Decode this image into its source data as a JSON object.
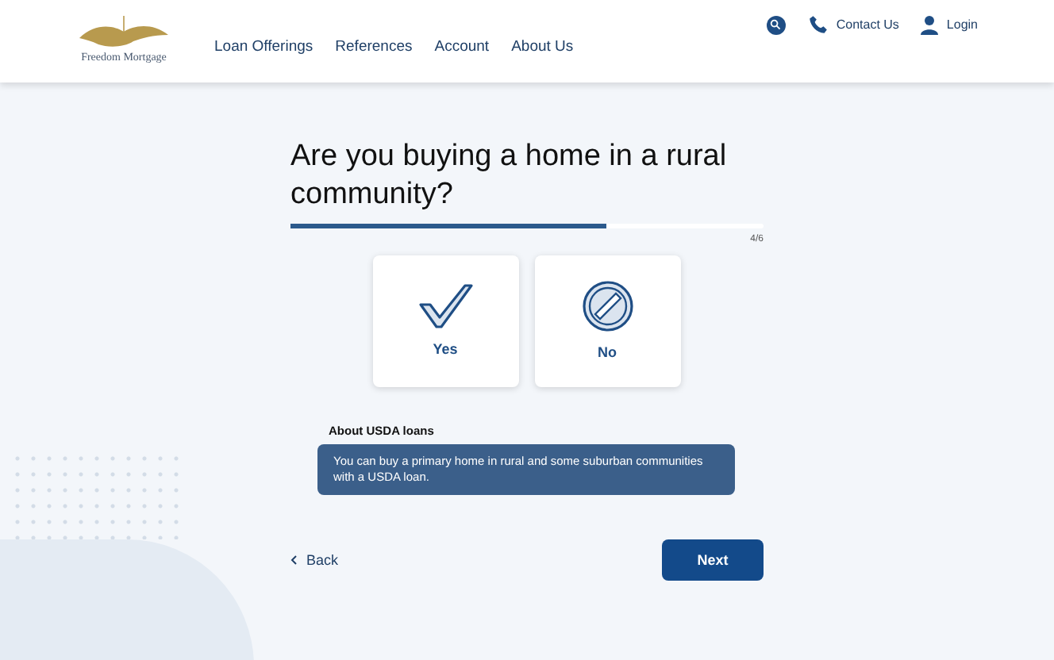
{
  "header": {
    "logo_text": "Freedom Mortgage",
    "nav": [
      "Loan Offerings",
      "References",
      "Account",
      "About Us"
    ],
    "utility_links": [
      {
        "kind": "phone",
        "label": "Contact Us"
      },
      {
        "kind": "user",
        "label": "Login"
      }
    ]
  },
  "question": "Are you buying a home in a rural community?",
  "progress": {
    "level": 0.667,
    "reading": "4/6"
  },
  "options": [
    {
      "kind": "yes",
      "label": "Yes",
      "selected": false
    },
    {
      "kind": "no",
      "label": "No",
      "selected": false
    }
  ],
  "info": {
    "title": "About USDA loans",
    "text": "You can buy a primary home in rural and some suburban communities with a USDA loan."
  },
  "back_label": "Back",
  "next_label": "Next"
}
